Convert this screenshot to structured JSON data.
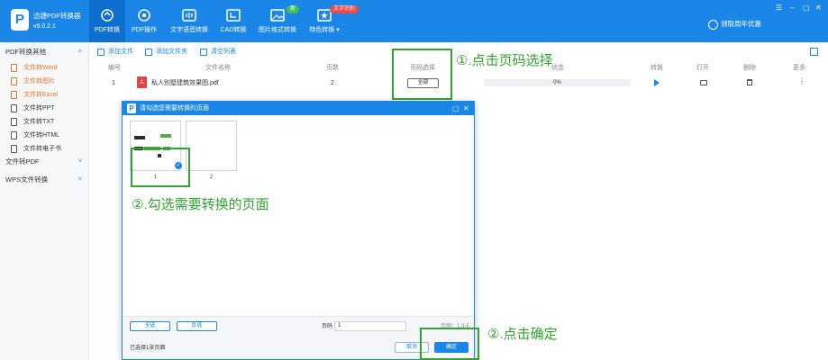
{
  "app": {
    "name": "迅捷PDF转换器",
    "version": "v9.0.2.1",
    "logo_letter": "P"
  },
  "nav": [
    {
      "label": "PDF转换",
      "icon": "refresh-icon",
      "active": true
    },
    {
      "label": "PDF操作",
      "icon": "settings-icon",
      "active": false
    },
    {
      "label": "文字语音转换",
      "icon": "audio-wave-icon",
      "active": false
    },
    {
      "label": "CAD转换",
      "icon": "cad-icon",
      "active": false
    },
    {
      "label": "图片格式转换",
      "icon": "image-icon",
      "active": false,
      "badge": "新"
    },
    {
      "label": "特色转换 ▾",
      "icon": "star-doc-icon",
      "active": false,
      "badge": "文字识别"
    }
  ],
  "promo": {
    "label": "领取周年优惠",
    "icon": "user-icon"
  },
  "window_controls": [
    "☰",
    "–",
    "▢",
    "✕"
  ],
  "sidebar": {
    "group1": "PDF转换其他",
    "items": [
      {
        "label": "文件转Word",
        "active": true
      },
      {
        "label": "文件转图片",
        "active": true
      },
      {
        "label": "文件转Excel",
        "active": true
      },
      {
        "label": "文件转PPT",
        "active": false
      },
      {
        "label": "文件转TXT",
        "active": false
      },
      {
        "label": "文件转HTML",
        "active": false
      },
      {
        "label": "文件转电子书",
        "active": false
      }
    ],
    "group2": "文件转PDF",
    "group3": "WPS文件转换"
  },
  "toolbar": {
    "add_file": "添加文件",
    "add_folder": "添加文件夹",
    "clear_list": "清空列表"
  },
  "table": {
    "headers": {
      "index": "编号",
      "filename": "文件名称",
      "pages": "页数",
      "page_select": "页码选择",
      "status": "状态",
      "convert": "转换",
      "open": "打开",
      "delete": "删除",
      "more": "更多"
    },
    "row": {
      "index": "1",
      "filename": "私人别墅建筑效果图.pdf",
      "pages": "2",
      "page_select_button": "全部",
      "progress": "0%",
      "progress_value": 0
    }
  },
  "annotations": {
    "step1": "①.点击页码选择",
    "step2": "②.勾选需要转换的页面",
    "step3": "②.点击确定"
  },
  "dialog": {
    "title": "请勾选您需要转换的页面",
    "thumbnails": [
      {
        "label": "1",
        "selected": true
      },
      {
        "label": "2",
        "selected": false
      }
    ],
    "select_all": "全选",
    "invert": "反选",
    "page_label": "页码",
    "page_value": "1",
    "example": "示例：1,3-5",
    "selected_status": "已选择1张页面",
    "cancel": "取消",
    "confirm": "确定"
  },
  "colors": {
    "primary": "#1a86e8",
    "annotation": "#2fa52f",
    "active_sidebar": "#e8742c"
  }
}
